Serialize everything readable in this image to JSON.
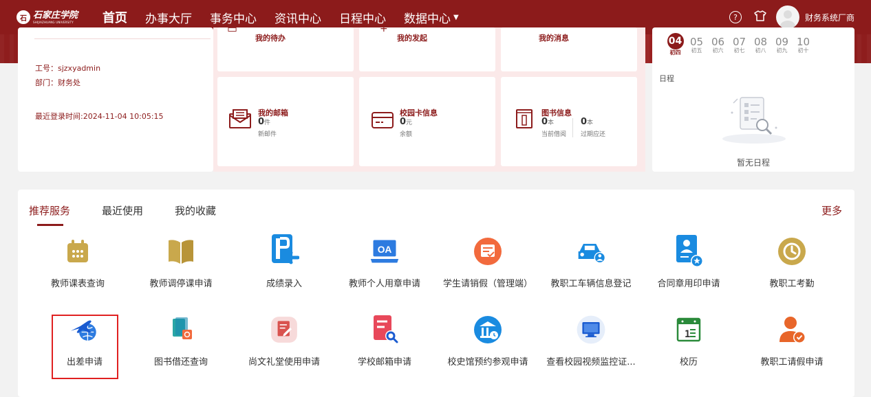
{
  "topbar": {
    "logo_cn": "石家庄学院",
    "logo_en": "SHIJIAZHUANG UNIVERSITY",
    "nav": [
      {
        "label": "首页"
      },
      {
        "label": "办事大厅"
      },
      {
        "label": "事务中心"
      },
      {
        "label": "资讯中心"
      },
      {
        "label": "日程中心"
      },
      {
        "label": "数据中心"
      }
    ],
    "username": "财务系统厂商"
  },
  "user_card": {
    "emp_id": "工号：sjzxyadmin",
    "dept": "部门：财务处",
    "last_login": "最近登录时间:2024-11-04 10:05:15"
  },
  "tiles": {
    "todo": {
      "label": "我的待办"
    },
    "started": {
      "label": "我的发起"
    },
    "messages": {
      "label": "我的消息"
    },
    "mailbox": {
      "label": "我的邮箱",
      "count": "0",
      "unit": "件",
      "sub": "新邮件"
    },
    "campus_card": {
      "label": "校园卡信息",
      "count": "0",
      "unit": "元",
      "sub": "余额"
    },
    "library": {
      "label": "图书信息",
      "borrow_count": "0",
      "borrow_unit": "本",
      "borrow_sub": "当前借阅",
      "overdue_count": "0",
      "overdue_unit": "本",
      "overdue_sub": "过期应还"
    }
  },
  "calendar": {
    "days": [
      {
        "d": "04",
        "l": "初四"
      },
      {
        "d": "05",
        "l": "初五"
      },
      {
        "d": "06",
        "l": "初六"
      },
      {
        "d": "07",
        "l": "初七"
      },
      {
        "d": "08",
        "l": "初八"
      },
      {
        "d": "09",
        "l": "初九"
      },
      {
        "d": "10",
        "l": "初十"
      }
    ],
    "schedule_label": "日程",
    "empty_text": "暂无日程"
  },
  "services": {
    "tabs": [
      "推荐服务",
      "最近使用",
      "我的收藏"
    ],
    "more": "更多",
    "items": [
      {
        "label": "教师课表查询",
        "icon": "calendar-icon",
        "color": "#c9a84c"
      },
      {
        "label": "教师调停课申请",
        "icon": "book-icon",
        "color": "#c9a84c"
      },
      {
        "label": "成绩录入",
        "icon": "grade-entry-icon",
        "color": "#1a8be0"
      },
      {
        "label": "教师个人用章申请",
        "icon": "oa-icon",
        "color": "#2d7be0"
      },
      {
        "label": "学生请销假（管理端）",
        "icon": "leave-icon",
        "color": "#f26a3d"
      },
      {
        "label": "教职工车辆信息登记",
        "icon": "car-icon",
        "color": "#1a8be0"
      },
      {
        "label": "合同章用印申请",
        "icon": "contract-icon",
        "color": "#1a8be0"
      },
      {
        "label": "教职工考勤",
        "icon": "clock-icon",
        "color": "#c9a84c"
      },
      {
        "label": "出差申请",
        "icon": "plane-icon",
        "color": "#1a5bd0"
      },
      {
        "label": "图书借还查询",
        "icon": "books-icon",
        "color": "#2aa6a6"
      },
      {
        "label": "尚文礼堂使用申请",
        "icon": "form-icon",
        "color": "#d9534f"
      },
      {
        "label": "学校邮箱申请",
        "icon": "mail-search-icon",
        "color": "#e8485a"
      },
      {
        "label": "校史馆预约参观申请",
        "icon": "museum-icon",
        "color": "#1a8be0"
      },
      {
        "label": "查看校园视频监控证...",
        "icon": "monitor-icon",
        "color": "#1a5bd0"
      },
      {
        "label": "校历",
        "icon": "school-calendar-icon",
        "color": "#2a8a3a"
      },
      {
        "label": "教职工请假申请",
        "icon": "staff-leave-icon",
        "color": "#e8662a"
      }
    ]
  }
}
